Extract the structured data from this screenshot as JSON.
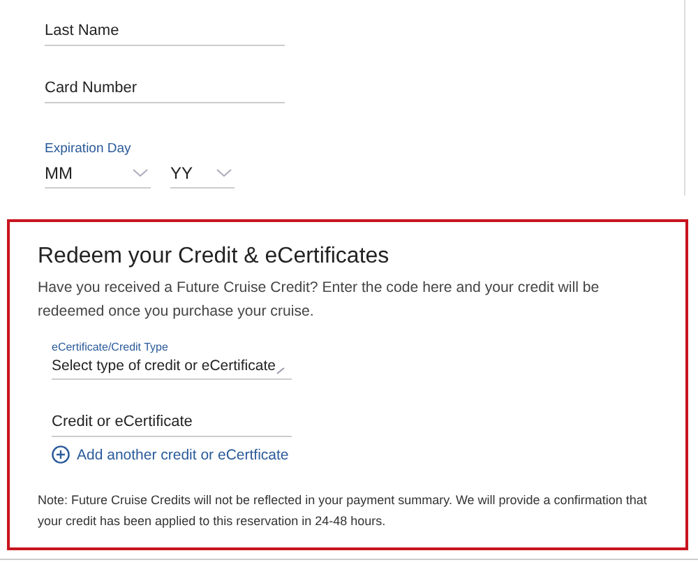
{
  "card_form": {
    "fields": [
      {
        "kind": "text",
        "placeholder": "Last Name"
      },
      {
        "kind": "text",
        "placeholder": "Card Number"
      },
      {
        "kind": "expiry",
        "label": "Expiration Day",
        "selects": [
          {
            "value": "MM"
          },
          {
            "value": "YY"
          }
        ]
      }
    ]
  },
  "redeem": {
    "title": "Redeem your Credit & eCertificates",
    "description": "Have you received a Future Cruise Credit? Enter the code here and your credit will be redeemed once you purchase your cruise.",
    "type_select": {
      "label": "eCertificate/Credit Type",
      "value": "Select type of credit or eCertificate"
    },
    "code_field": {
      "placeholder": "Credit or eCertificate"
    },
    "add_link": "Add another credit or eCertficate",
    "note": "Note: Future Cruise Credits will not be reflected in your payment summary. We will provide a confirmation that your credit has been applied to this reservation in 24-48 hours."
  }
}
